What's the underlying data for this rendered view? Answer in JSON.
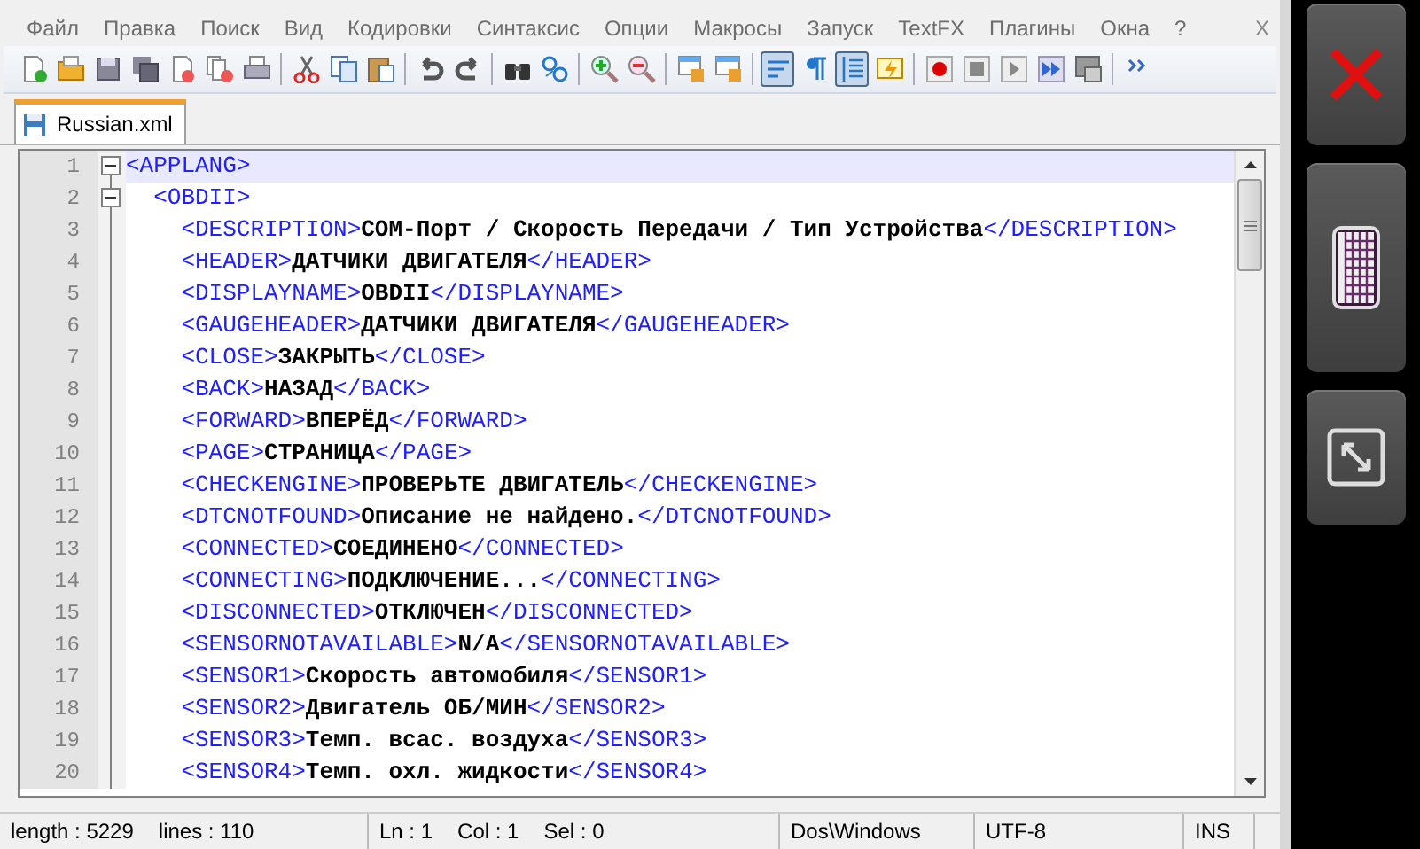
{
  "menu": [
    {
      "label": "Файл"
    },
    {
      "label": "Правка"
    },
    {
      "label": "Поиск"
    },
    {
      "label": "Вид"
    },
    {
      "label": "Кодировки"
    },
    {
      "label": "Синтаксис"
    },
    {
      "label": "Опции"
    },
    {
      "label": "Макросы"
    },
    {
      "label": "Запуск"
    },
    {
      "label": "TextFX"
    },
    {
      "label": "Плагины"
    },
    {
      "label": "Окна"
    },
    {
      "label": "?"
    }
  ],
  "menu_close": "X",
  "toolbar": [
    {
      "kind": "new",
      "pressed": false
    },
    {
      "kind": "open",
      "pressed": false
    },
    {
      "kind": "save",
      "pressed": false
    },
    {
      "kind": "saveall",
      "pressed": false
    },
    {
      "kind": "close",
      "pressed": false
    },
    {
      "kind": "closeall",
      "pressed": false
    },
    {
      "kind": "print",
      "pressed": false
    },
    {
      "kind": "sep"
    },
    {
      "kind": "cut",
      "pressed": false
    },
    {
      "kind": "copy",
      "pressed": false
    },
    {
      "kind": "paste",
      "pressed": false
    },
    {
      "kind": "sep"
    },
    {
      "kind": "undo",
      "pressed": false
    },
    {
      "kind": "redo",
      "pressed": false
    },
    {
      "kind": "sep"
    },
    {
      "kind": "find",
      "pressed": false
    },
    {
      "kind": "replace",
      "pressed": false
    },
    {
      "kind": "sep"
    },
    {
      "kind": "zoomin",
      "pressed": false
    },
    {
      "kind": "zoomout",
      "pressed": false
    },
    {
      "kind": "sep"
    },
    {
      "kind": "syncv",
      "pressed": false
    },
    {
      "kind": "synch",
      "pressed": false
    },
    {
      "kind": "sep"
    },
    {
      "kind": "wrap",
      "pressed": true
    },
    {
      "kind": "chars",
      "pressed": false
    },
    {
      "kind": "indent",
      "pressed": true
    },
    {
      "kind": "lang",
      "pressed": false
    },
    {
      "kind": "sep"
    },
    {
      "kind": "record",
      "pressed": false
    },
    {
      "kind": "stop",
      "pressed": false
    },
    {
      "kind": "play",
      "pressed": false
    },
    {
      "kind": "playmulti",
      "pressed": false
    },
    {
      "kind": "savemacro",
      "pressed": false
    },
    {
      "kind": "sep"
    },
    {
      "kind": "more",
      "pressed": false
    }
  ],
  "tabs": [
    {
      "label": "Russian.xml",
      "selected": true
    }
  ],
  "editor": {
    "lines": [
      {
        "number": "1",
        "expanded": true,
        "current": true,
        "open": "<APPLANG>",
        "children": [
          {
            "number": "2",
            "expanded": true,
            "current": false,
            "open": "<OBDII>",
            "children": [
              {
                "number": "3",
                "current": false,
                "open": "<DESCRIPTION>",
                "text": "COM-Порт / Скорость Передачи / Тип Устройства",
                "close": "</DESCRIPTION>"
              },
              {
                "number": "4",
                "current": false,
                "open": "<HEADER>",
                "text": "ДАТЧИКИ ДВИГАТЕЛЯ",
                "close": "</HEADER>"
              },
              {
                "number": "5",
                "current": false,
                "open": "<DISPLAYNAME>",
                "text": "OBDII",
                "close": "</DISPLAYNAME>"
              },
              {
                "number": "6",
                "current": false,
                "open": "<GAUGEHEADER>",
                "text": "ДАТЧИКИ ДВИГАТЕЛЯ",
                "close": "</GAUGEHEADER>"
              },
              {
                "number": "7",
                "current": false,
                "open": "<CLOSE>",
                "text": "ЗАКРЫТЬ",
                "close": "</CLOSE>"
              },
              {
                "number": "8",
                "current": false,
                "open": "<BACK>",
                "text": "НАЗАД",
                "close": "</BACK>"
              },
              {
                "number": "9",
                "current": false,
                "open": "<FORWARD>",
                "text": "ВПЕРЁД",
                "close": "</FORWARD>"
              },
              {
                "number": "10",
                "current": false,
                "open": "<PAGE>",
                "text": "СТРАНИЦА",
                "close": "</PAGE>"
              },
              {
                "number": "11",
                "current": false,
                "open": "<CHECKENGINE>",
                "text": "ПРОВЕРЬТЕ ДВИГАТЕЛЬ",
                "close": "</CHECKENGINE>"
              },
              {
                "number": "12",
                "current": false,
                "open": "<DTCNOTFOUND>",
                "text": "Описание не найдено.",
                "close": "</DTCNOTFOUND>"
              },
              {
                "number": "13",
                "current": false,
                "open": "<CONNECTED>",
                "text": "СОЕДИНЕНО",
                "close": "</CONNECTED>"
              },
              {
                "number": "14",
                "current": false,
                "open": "<CONNECTING>",
                "text": "ПОДКЛЮЧЕНИЕ...",
                "close": "</CONNECTING>"
              },
              {
                "number": "15",
                "current": false,
                "open": "<DISCONNECTED>",
                "text": "ОТКЛЮЧЕН",
                "close": "</DISCONNECTED>"
              },
              {
                "number": "16",
                "current": false,
                "open": "<SENSORNOTAVAILABLE>",
                "text": "N/A",
                "close": "</SENSORNOTAVAILABLE>"
              },
              {
                "number": "17",
                "current": false,
                "open": "<SENSOR1>",
                "text": "Скорость автомобиля",
                "close": "</SENSOR1>"
              },
              {
                "number": "18",
                "current": false,
                "open": "<SENSOR2>",
                "text": "Двигатель ОБ/МИН",
                "close": "</SENSOR2>"
              },
              {
                "number": "19",
                "current": false,
                "open": "<SENSOR3>",
                "text": "Темп. всас. воздуха",
                "close": "</SENSOR3>"
              },
              {
                "number": "20",
                "current": false,
                "open": "<SENSOR4>",
                "text": "Темп. охл. жидкости",
                "close": "</SENSOR4>"
              }
            ]
          }
        ]
      }
    ]
  },
  "status_bar": [
    {
      "kind": "counts",
      "parts": [
        "length : 5229",
        "lines : 110"
      ]
    },
    {
      "kind": "position",
      "parts": [
        "Ln : 1",
        "Col : 1",
        "Sel : 0"
      ]
    },
    {
      "kind": "eol",
      "parts": [
        "Dos\\Windows"
      ]
    },
    {
      "kind": "encoding",
      "parts": [
        "UTF-8"
      ]
    },
    {
      "kind": "mode",
      "parts": [
        "INS"
      ]
    }
  ],
  "side_buttons": [
    {
      "kind": "close"
    },
    {
      "kind": "keyboard"
    },
    {
      "kind": "resize"
    }
  ]
}
